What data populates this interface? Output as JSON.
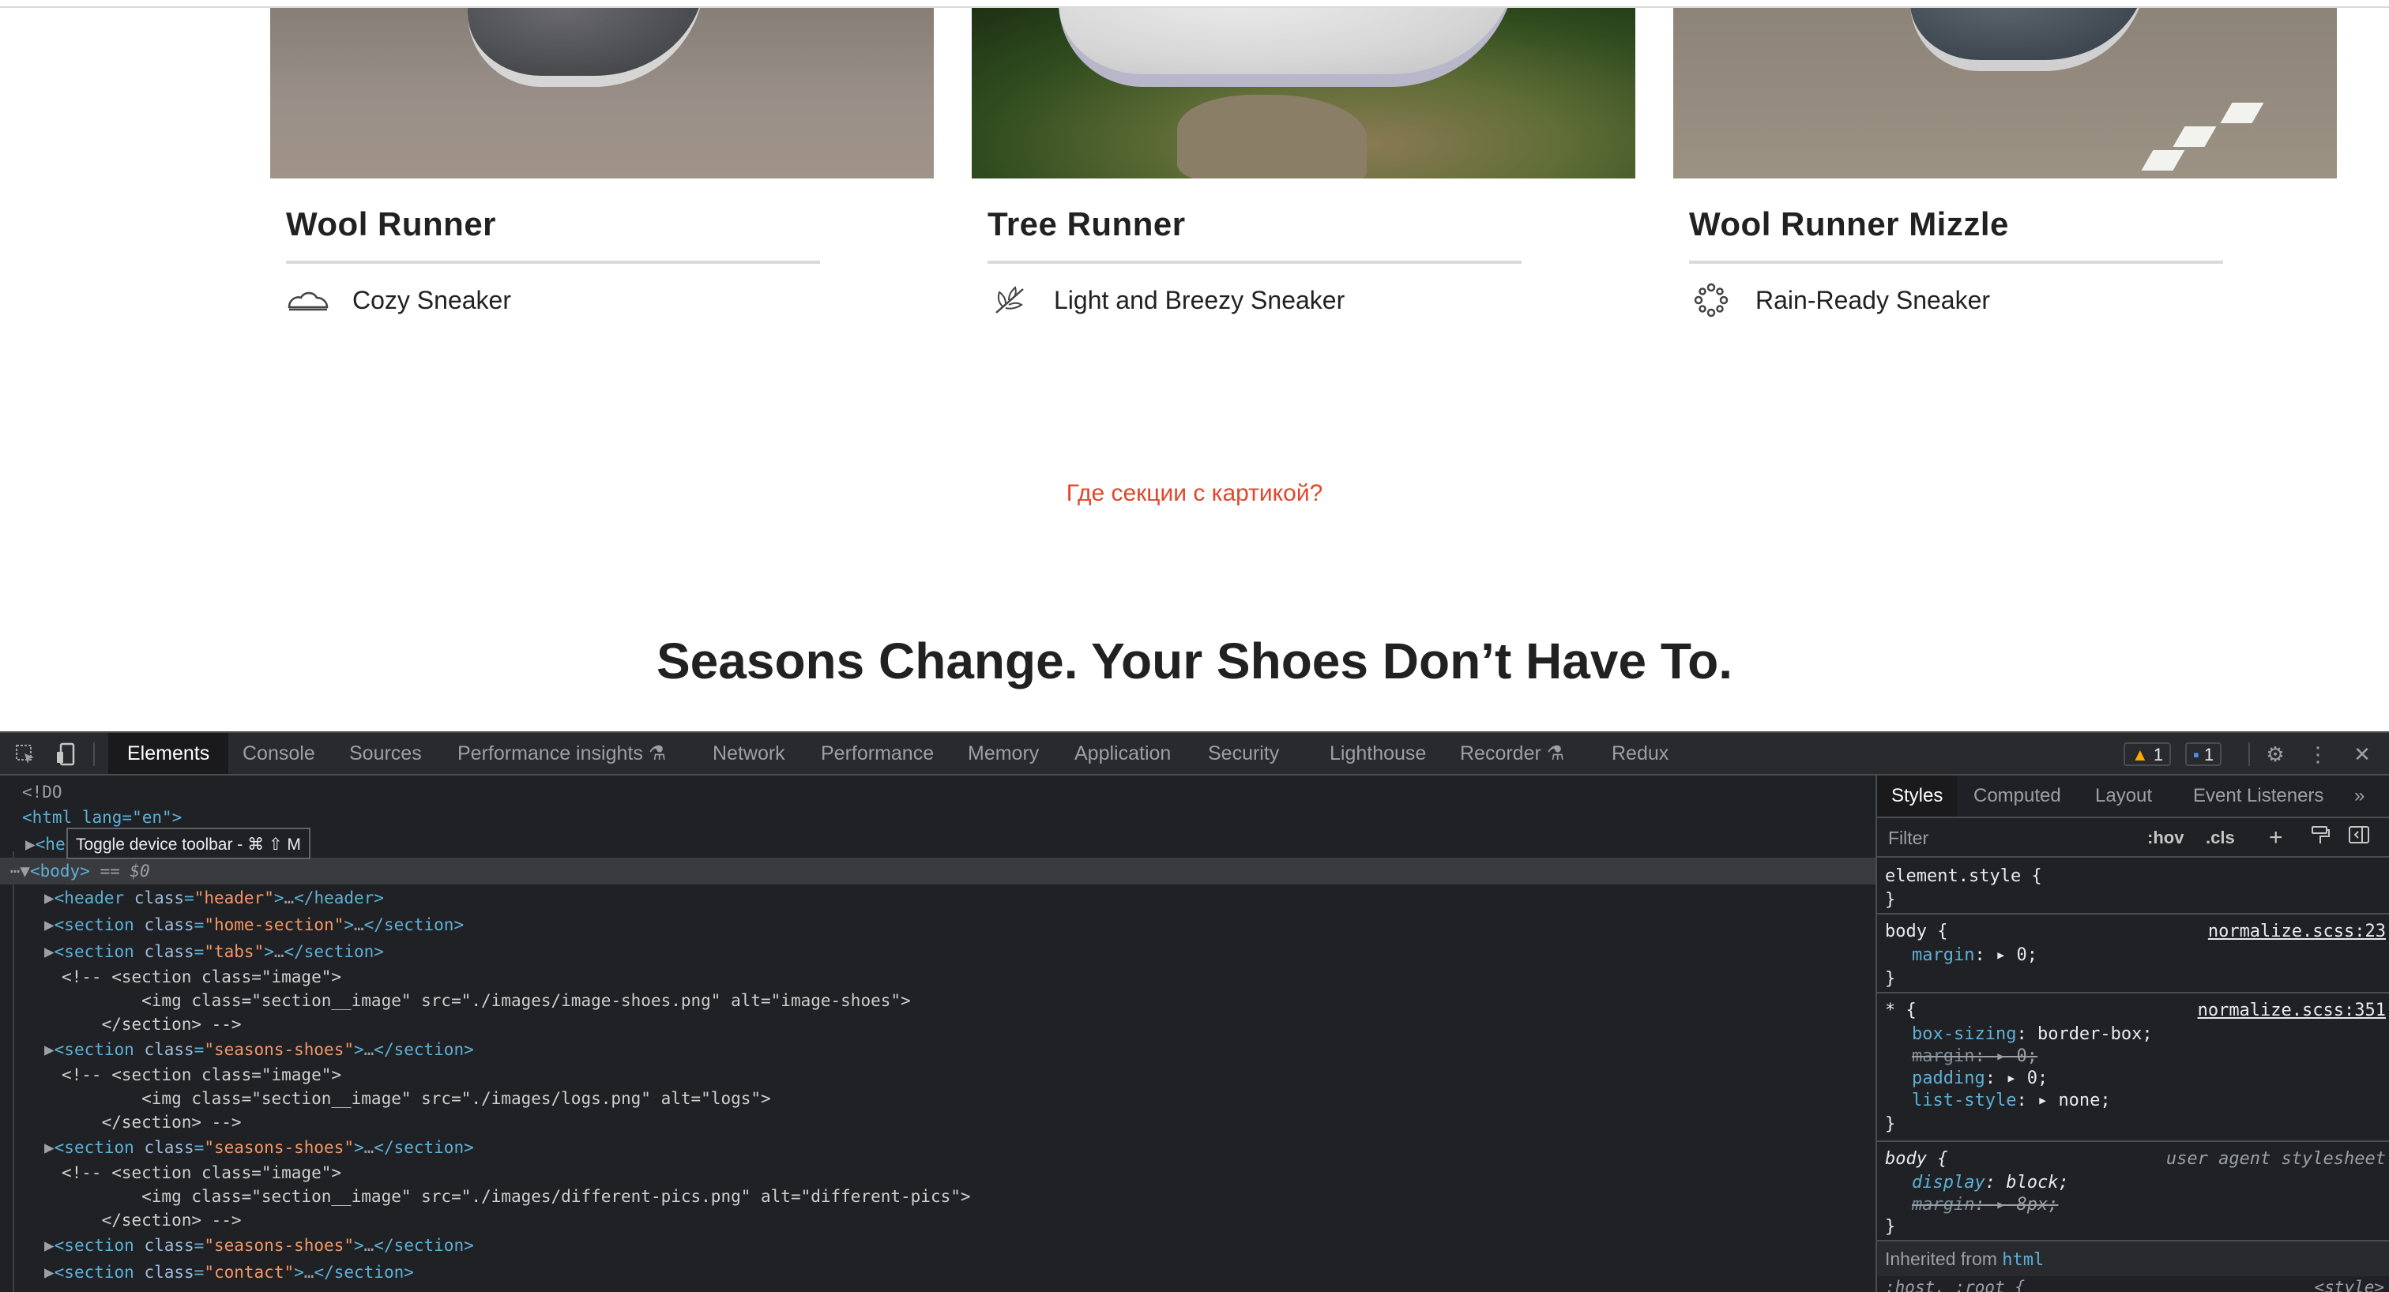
{
  "page": {
    "cards": [
      {
        "title": "Wool Runner",
        "subtitle": "Cozy Sneaker",
        "icon": "cloud-shoe-icon",
        "image_alt": "wool-runner-image"
      },
      {
        "title": "Tree Runner",
        "subtitle": "Light and Breezy Sneaker",
        "icon": "leaf-icon",
        "image_alt": "tree-runner-image"
      },
      {
        "title": "Wool Runner Mizzle",
        "subtitle": "Rain-Ready Sneaker",
        "icon": "rain-icon",
        "image_alt": "wool-runner-mizzle-image"
      }
    ],
    "question": "Где секции с картикой?",
    "seasons_heading": "Seasons Change. Your Shoes Don’t Have To."
  },
  "devtools": {
    "tabs": [
      "Elements",
      "Console",
      "Sources",
      "Performance insights",
      "Network",
      "Performance",
      "Memory",
      "Application",
      "Security",
      "Lighthouse",
      "Recorder",
      "Redux"
    ],
    "active_tab": "Elements",
    "flask_icon_tabs": [
      "Performance insights",
      "Recorder"
    ],
    "warnings_count": "1",
    "messages_count": "1",
    "tooltip": "Toggle device toolbar - ⌘ ⇧ M",
    "dom": {
      "doctype_fragment": "<!DO",
      "html_open": "<html lang=\"en\">",
      "head": "<head>…</head>",
      "body_selected": "<body>",
      "body_marker": "== $0",
      "children": [
        {
          "kind": "element",
          "tag": "header",
          "class": "header"
        },
        {
          "kind": "element",
          "tag": "section",
          "class": "home-section"
        },
        {
          "kind": "element",
          "tag": "section",
          "class": "tabs"
        },
        {
          "kind": "comment",
          "lines": [
            "<!-- <section class=\"image\">",
            "        <img class=\"section__image\" src=\"./images/image-shoes.png\" alt=\"image-shoes\">",
            "    </section> -->"
          ]
        },
        {
          "kind": "element",
          "tag": "section",
          "class": "seasons-shoes"
        },
        {
          "kind": "comment",
          "lines": [
            "<!-- <section class=\"image\">",
            "        <img class=\"section__image\" src=\"./images/logs.png\" alt=\"logs\">",
            "    </section> -->"
          ]
        },
        {
          "kind": "element",
          "tag": "section",
          "class": "seasons-shoes"
        },
        {
          "kind": "comment",
          "lines": [
            "<!-- <section class=\"image\">",
            "        <img class=\"section__image\" src=\"./images/different-pics.png\" alt=\"different-pics\">",
            "    </section> -->"
          ]
        },
        {
          "kind": "element",
          "tag": "section",
          "class": "seasons-shoes"
        },
        {
          "kind": "element",
          "tag": "section",
          "class": "contact"
        }
      ]
    },
    "styles": {
      "tabs": [
        "Styles",
        "Computed",
        "Layout",
        "Event Listeners"
      ],
      "active_tab": "Styles",
      "more_label": "»",
      "filter_placeholder": "Filter",
      "hov_label": ":hov",
      "cls_label": ".cls",
      "rules": [
        {
          "selector": "element.style {",
          "source": "",
          "decls": []
        },
        {
          "selector": "body {",
          "source": "normalize.scss:23",
          "decls": [
            {
              "prop": "margin",
              "value": "0",
              "struck": false
            }
          ]
        },
        {
          "selector": "* {",
          "source": "normalize.scss:351",
          "decls": [
            {
              "prop": "box-sizing",
              "value": "border-box",
              "struck": false
            },
            {
              "prop": "margin",
              "value": "0",
              "struck": true
            },
            {
              "prop": "padding",
              "value": "0",
              "struck": false
            },
            {
              "prop": "list-style",
              "value": "none",
              "struck": false
            }
          ]
        },
        {
          "selector": "body {",
          "source": "user agent stylesheet",
          "decls": [
            {
              "prop": "display",
              "value": "block",
              "struck": false
            },
            {
              "prop": "margin",
              "value": "8px",
              "struck": true
            }
          ]
        }
      ],
      "inherited_label": "Inherited from",
      "inherited_from": "html",
      "trailing_fragment": ":host, :root {",
      "trailing_source": "<style>"
    }
  },
  "colors": {
    "accent_red": "#e0472c",
    "devtools_bg": "#202124",
    "tag_blue": "#5db0d7",
    "attr_value_orange": "#f29766"
  }
}
